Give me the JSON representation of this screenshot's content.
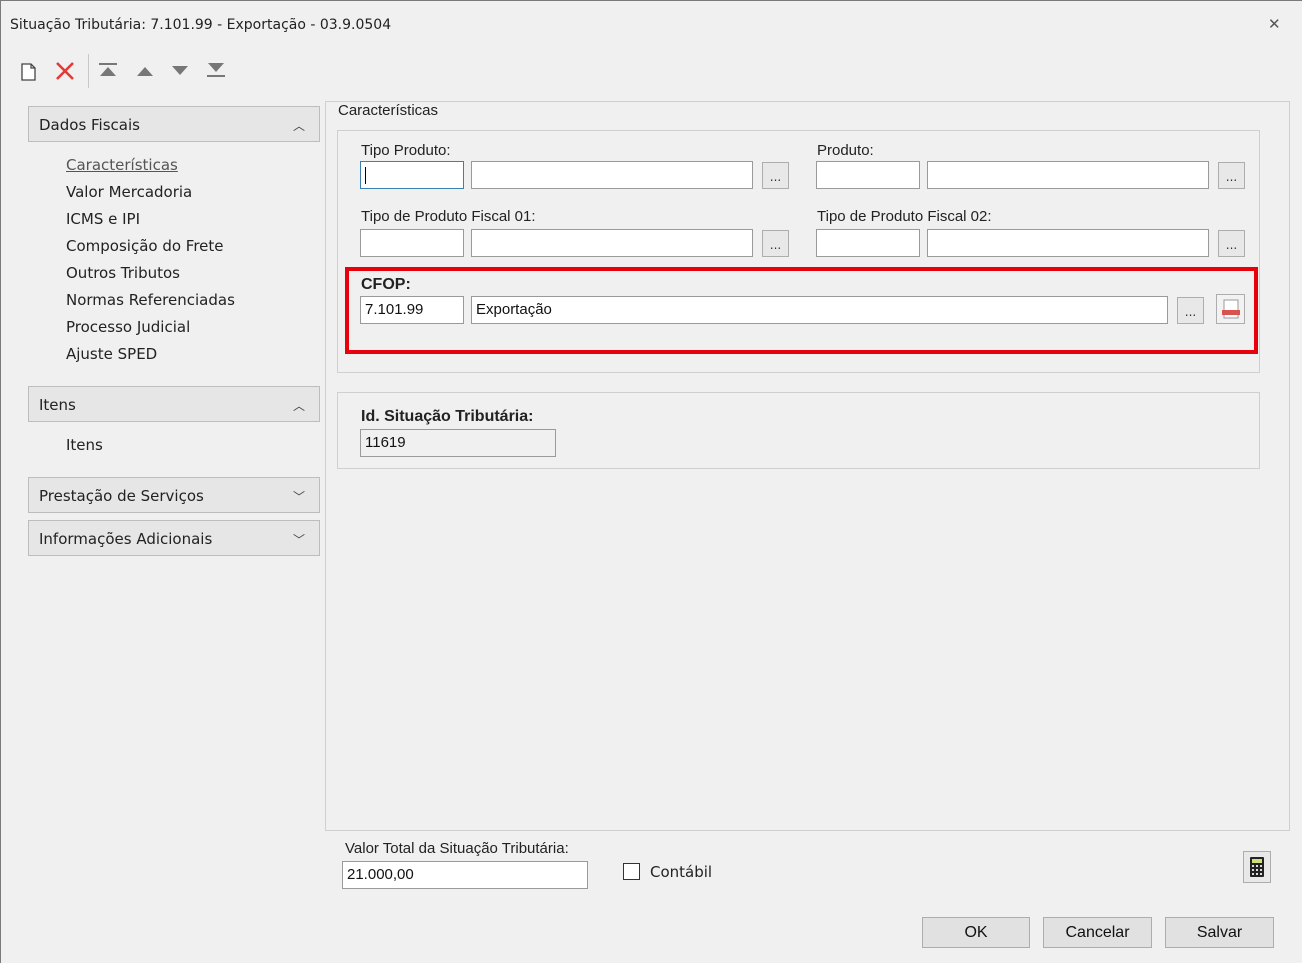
{
  "window": {
    "title": "Situação Tributária: 7.101.99 - Exportação - 03.9.0504"
  },
  "toolbar": {
    "new_icon": "new-document-icon",
    "delete_icon": "delete-x-icon",
    "first_icon": "move-first-icon",
    "up_icon": "move-up-icon",
    "down_icon": "move-down-icon",
    "last_icon": "move-last-icon"
  },
  "sidebar": {
    "sections": [
      {
        "label": "Dados Fiscais",
        "expanded": true
      },
      {
        "label": "Itens",
        "expanded": true
      },
      {
        "label": "Prestação de Serviços",
        "expanded": false
      },
      {
        "label": "Informações Adicionais",
        "expanded": false
      }
    ],
    "dados_fiscais_items": [
      "Características",
      "Valor Mercadoria",
      "ICMS e IPI",
      "Composição do Frete",
      "Outros Tributos",
      "Normas Referenciadas",
      "Processo Judicial",
      "Ajuste SPED"
    ],
    "itens_items": [
      "Itens"
    ],
    "active_item": "Características"
  },
  "main": {
    "group_title": "Características",
    "tipo_produto": {
      "label": "Tipo Produto:",
      "code": "",
      "desc": ""
    },
    "produto": {
      "label": "Produto:",
      "code": "",
      "desc": ""
    },
    "tipo_fiscal_01": {
      "label": "Tipo de Produto Fiscal 01:",
      "code": "",
      "desc": ""
    },
    "tipo_fiscal_02": {
      "label": "Tipo de Produto Fiscal 02:",
      "code": "",
      "desc": ""
    },
    "cfop": {
      "label": "CFOP:",
      "code": "7.101.99",
      "desc": "Exportação"
    },
    "id_situacao": {
      "label": "Id. Situação Tributária:",
      "value": "11619"
    },
    "lookup_label": "..."
  },
  "footer": {
    "valor_total_label": "Valor Total da Situação Tributária:",
    "valor_total": "21.000,00",
    "contabil_label": "Contábil",
    "contabil_checked": false
  },
  "buttons": {
    "ok": "OK",
    "cancel": "Cancelar",
    "save": "Salvar"
  },
  "colors": {
    "highlight": "#e8000b",
    "delete_icon": "#e53935"
  }
}
